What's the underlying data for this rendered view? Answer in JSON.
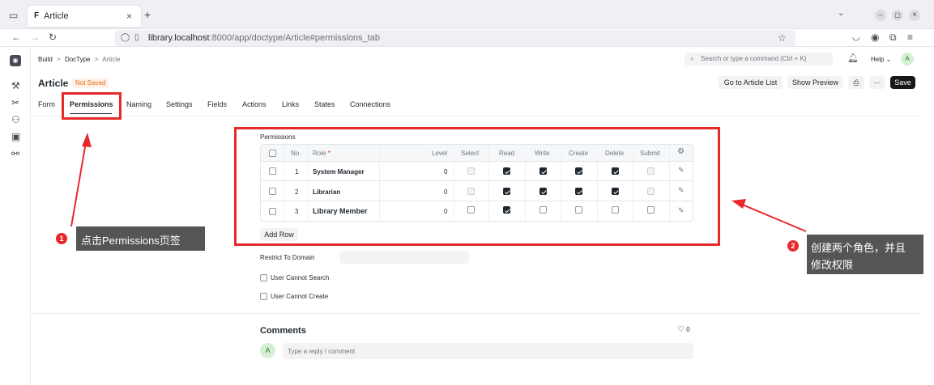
{
  "browser": {
    "tab_title": "Article",
    "url_host": "library.localhost",
    "url_rest": ":8000/app/doctype/Article#permissions_tab"
  },
  "breadcrumb": {
    "items": [
      "Build",
      "DocType",
      "Article"
    ],
    "separator": ">"
  },
  "search": {
    "placeholder": "Search or type a command (Ctrl + K)"
  },
  "navbar": {
    "help_label": "Help",
    "avatar_letter": "A"
  },
  "doc": {
    "title": "Article",
    "status": "Not Saved",
    "go_to_list": "Go to Article List",
    "show_preview": "Show Preview",
    "more": "···",
    "save": "Save"
  },
  "tabs": [
    "Form",
    "Permissions",
    "Naming",
    "Settings",
    "Fields",
    "Actions",
    "Links",
    "States",
    "Connections"
  ],
  "active_tab": "Permissions",
  "permissions": {
    "section_label": "Permissions",
    "columns": [
      "No.",
      "Role",
      "Level",
      "Select",
      "Read",
      "Write",
      "Create",
      "Delete",
      "Submit"
    ],
    "role_required_mark": "*",
    "rows": [
      {
        "no": "1",
        "role": "System Manager",
        "level": "0",
        "select": "disabled",
        "read": true,
        "write": true,
        "create": true,
        "delete": true,
        "submit": "disabled"
      },
      {
        "no": "2",
        "role": "Librarian",
        "level": "0",
        "select": "disabled",
        "read": true,
        "write": true,
        "create": true,
        "delete": true,
        "submit": "disabled"
      },
      {
        "no": "3",
        "role": "Library Member",
        "level": "0",
        "select": false,
        "read": true,
        "write": false,
        "create": false,
        "delete": false,
        "submit": false
      }
    ],
    "add_row": "Add Row"
  },
  "fields": {
    "restrict_to_domain": "Restrict To Domain",
    "user_cannot_search": "User Cannot Search",
    "user_cannot_create": "User Cannot Create"
  },
  "comments": {
    "title": "Comments",
    "like_count": "0",
    "avatar_letter": "A",
    "placeholder": "Type a reply / comment"
  },
  "annotations": {
    "callout1_num": "1",
    "callout1_text": "点击Permissions页签",
    "callout2_num": "2",
    "callout2_line1": "创建两个角色，并且",
    "callout2_line2": "修改权限"
  },
  "colors": {
    "annotation_red": "#e8292c",
    "callout_bg": "#555555",
    "status_orange": "#e86c13",
    "primary": "#171717"
  }
}
